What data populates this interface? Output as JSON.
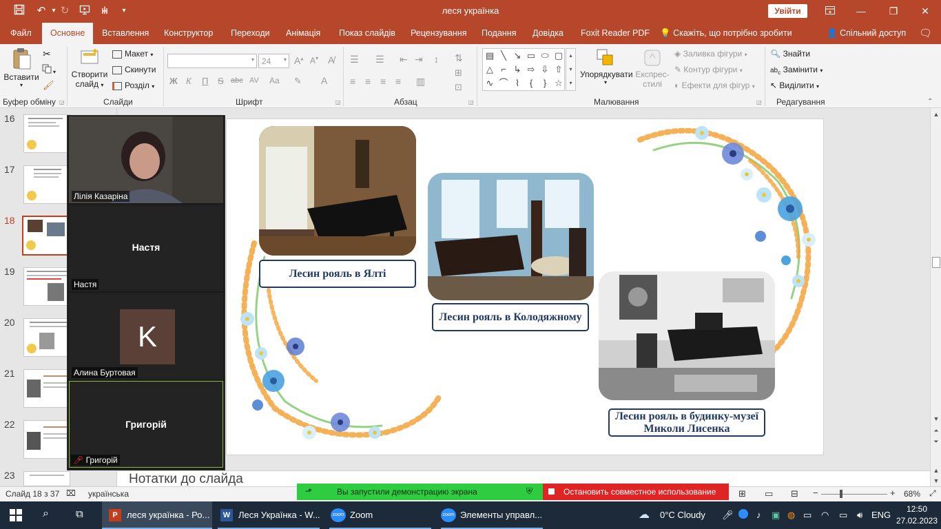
{
  "app": {
    "title": "леся українка",
    "signin": "Увійти"
  },
  "tabs": [
    {
      "label": "Файл"
    },
    {
      "label": "Основне"
    },
    {
      "label": "Вставлення"
    },
    {
      "label": "Конструктор"
    },
    {
      "label": "Переходи"
    },
    {
      "label": "Анімація"
    },
    {
      "label": "Показ слайдів"
    },
    {
      "label": "Рецензування"
    },
    {
      "label": "Подання"
    },
    {
      "label": "Довідка"
    },
    {
      "label": "Foxit Reader PDF"
    },
    {
      "label": "Скажіть, що потрібно зробити"
    },
    {
      "label": "Спільний доступ"
    }
  ],
  "ribbon": {
    "clipboard": {
      "paste": "Вставити",
      "label": "Буфер обміну"
    },
    "slides": {
      "new_slide_1": "Створити",
      "new_slide_2": "слайд",
      "layout": "Макет",
      "reset": "Скинути",
      "section": "Розділ",
      "label": "Слайди"
    },
    "font": {
      "name_value": "",
      "size_value": "24",
      "label": "Шрифт",
      "bold": "Ж",
      "italic": "К",
      "underline": "П",
      "strike": "S",
      "abc": "abc",
      "spacing": "AV",
      "case": "Aa"
    },
    "paragraph": {
      "label": "Абзац"
    },
    "drawing": {
      "arrange_1": "Упорядкувати",
      "quick_styles_1": "Експрес-",
      "quick_styles_2": "стилі",
      "fill": "Заливка фігури",
      "outline": "Контур фігури",
      "effects": "Ефекти для фігур",
      "label": "Малювання"
    },
    "editing": {
      "find": "Знайти",
      "replace": "Замінити",
      "select": "Виділити",
      "label": "Редагування"
    }
  },
  "thumbnails": [
    {
      "num": "16"
    },
    {
      "num": "17"
    },
    {
      "num": "18"
    },
    {
      "num": "19"
    },
    {
      "num": "20"
    },
    {
      "num": "21"
    },
    {
      "num": "22"
    },
    {
      "num": "23"
    }
  ],
  "zoom": {
    "participants": [
      {
        "name": "Лілія Казаріна",
        "center": ""
      },
      {
        "name": "Настя",
        "center": "Настя"
      },
      {
        "name": "Алина Буртовая",
        "center": "",
        "initial": "K"
      },
      {
        "name": "Григорій",
        "center": "Григорій"
      }
    ]
  },
  "slide": {
    "captions": {
      "yalta": "Лесин рояль в Ялті",
      "kolodyazhne": "Лесин рояль в Колодяжному",
      "lysenko": "Лесин рояль в будинку-музеї Миколи Лисенка"
    }
  },
  "notes": {
    "placeholder": "Нотатки до слайда"
  },
  "status": {
    "slide_info": "Слайд 18 з 37",
    "language": "українська",
    "share_started": "Вы запустили демонстрацию экрана",
    "stop_share": "Остановить совместное использование",
    "zoom_level": "68%"
  },
  "taskbar": {
    "apps": [
      {
        "label": "леся українка - Ро..."
      },
      {
        "label": "Леся Українка - W..."
      },
      {
        "label": "Zoom"
      },
      {
        "label": "Элементы управл..."
      }
    ],
    "weather": "0°C  Cloudy",
    "lang": "ENG",
    "time": "12:50",
    "date": "27.02.2023"
  }
}
